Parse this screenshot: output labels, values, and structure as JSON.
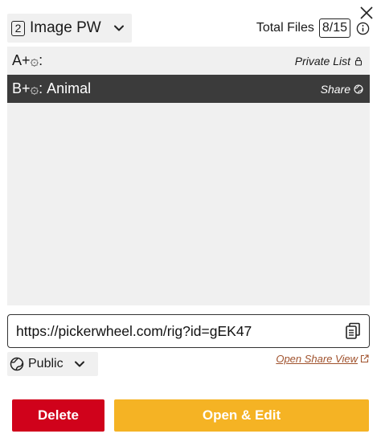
{
  "header": {
    "type_number": "2",
    "type_label": "Image PW",
    "total_label": "Total Files",
    "total_count": "8/15",
    "icons": {
      "close": "close-icon",
      "chevron": "chevron-down-icon",
      "info": "info-icon"
    }
  },
  "list": {
    "items": [
      {
        "name": "A+۞:",
        "meta": "Private List",
        "meta_icon": "lock-icon",
        "selected": false
      },
      {
        "name": "B+۞: Animal",
        "meta": "Share",
        "meta_icon": "globe-icon",
        "selected": true
      }
    ]
  },
  "share": {
    "url": "https://pickerwheel.com/rig?id=gEK47",
    "copy_icon": "copy-icon",
    "visibility": "Public",
    "visibility_icon": "globe-icon",
    "open_share_view": "Open Share View",
    "open_share_icon": "external-link-icon"
  },
  "actions": {
    "delete_label": "Delete",
    "open_label": "Open & Edit"
  },
  "colors": {
    "delete": "#d0021b",
    "open": "#f5b324",
    "selected_row": "#3b3b3b",
    "list_bg": "#f0f0f0",
    "link": "#a0522d"
  }
}
